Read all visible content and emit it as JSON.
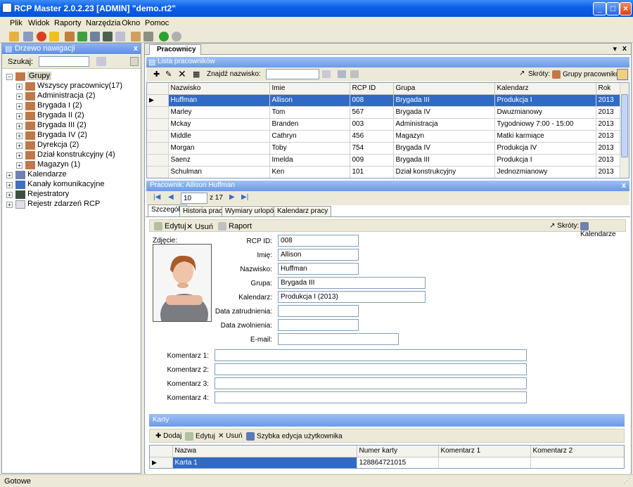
{
  "window": {
    "title": "RCP Master 2.0.2.23  [ADMIN] \"demo.rt2\""
  },
  "menu": [
    "Plik",
    "Widok",
    "Raporty",
    "Narzędzia",
    "Okno",
    "Pomoc"
  ],
  "nav": {
    "title": "Drzewo nawigacji",
    "close": "x",
    "search_label": "Szukaj:",
    "tree": {
      "groups": "Grupy",
      "items": [
        "Wszyscy pracownicy(17)",
        "Administracja (2)",
        "Brygada I (2)",
        "Brygada II (2)",
        "Brygada III (2)",
        "Brygada IV (2)",
        "Dyrekcja (2)",
        "Dział konstrukcyjny (4)",
        "Magazyn (1)"
      ],
      "roots": [
        "Kalendarze",
        "Kanały komunikacyjne",
        "Rejestratory",
        "Rejestr zdarzeń RCP"
      ]
    }
  },
  "doc": {
    "tab": "Pracownicy",
    "pin": "▾",
    "close": "x"
  },
  "list": {
    "title": "Lista pracowników",
    "find_label": "Znajdź nazwisko:",
    "shortcuts_label": "Skróty:",
    "groups_button": "Grupy pracowników",
    "columns": [
      "Nazwisko",
      "Imie",
      "RCP ID",
      "Grupa",
      "Kalendarz",
      "Rok"
    ],
    "rows": [
      [
        "Huffman",
        "Allison",
        "008",
        "Brygada III",
        "Produkcja I",
        "2013"
      ],
      [
        "Marley",
        "Tom",
        "567",
        "Brygada IV",
        "Dwuzmianowy",
        "2013"
      ],
      [
        "Mckay",
        "Branden",
        "003",
        "Administracja",
        "Tygodniowy 7:00 - 15:00",
        "2013"
      ],
      [
        "Middle",
        "Cathryn",
        "456",
        "Magazyn",
        "Matki karmiące",
        "2013"
      ],
      [
        "Morgan",
        "Toby",
        "754",
        "Brygada IV",
        "Produkcja IV",
        "2013"
      ],
      [
        "Saenz",
        "Imelda",
        "009",
        "Brygada III",
        "Produkcja I",
        "2013"
      ],
      [
        "Schulman",
        "Ken",
        "101",
        "Dział konstrukcyjny",
        "Jednozmianowy",
        "2013"
      ]
    ]
  },
  "detail": {
    "title": "Pracownik: Allison Huffman",
    "close": "x",
    "pager": {
      "current": "10",
      "of": "z 17"
    },
    "tabs": [
      "Szczegóły",
      "Historia pracy",
      "Wymiary urlopów",
      "Kalendarz pracy"
    ],
    "edit": "Edytuj",
    "delete": "Usuń",
    "report": "Raport",
    "shortcuts_label": "Skróty:",
    "calendar": "Kalendarze",
    "photo_label": "Zdjęcie:",
    "fields": [
      {
        "label": "RCP ID:",
        "value": "008"
      },
      {
        "label": "Imię:",
        "value": "Allison"
      },
      {
        "label": "Nazwisko:",
        "value": "Huffman"
      },
      {
        "label": "Grupa:",
        "value": "Brygada III"
      },
      {
        "label": "Kalendarz:",
        "value": "Produkcja I  (2013)"
      },
      {
        "label": "Data zatrudnienia:",
        "value": ""
      },
      {
        "label": "Data zwolnienia:",
        "value": ""
      },
      {
        "label": "E-mail:",
        "value": ""
      }
    ],
    "comments": [
      "Komentarz 1:",
      "Komentarz 2:",
      "Komentarz 3:",
      "Komentarz 4:"
    ],
    "cards": {
      "title": "Karty",
      "add": "Dodaj",
      "edit": "Edytuj",
      "delete": "Usuń",
      "quick": "Szybka edycja użytkownika",
      "columns": [
        "Nazwa",
        "Numer karty",
        "Komentarz 1",
        "Komentarz 2"
      ],
      "rows": [
        [
          "Karta 1",
          "128864721015",
          "",
          ""
        ]
      ]
    }
  },
  "status": {
    "text": "Gotowe"
  }
}
